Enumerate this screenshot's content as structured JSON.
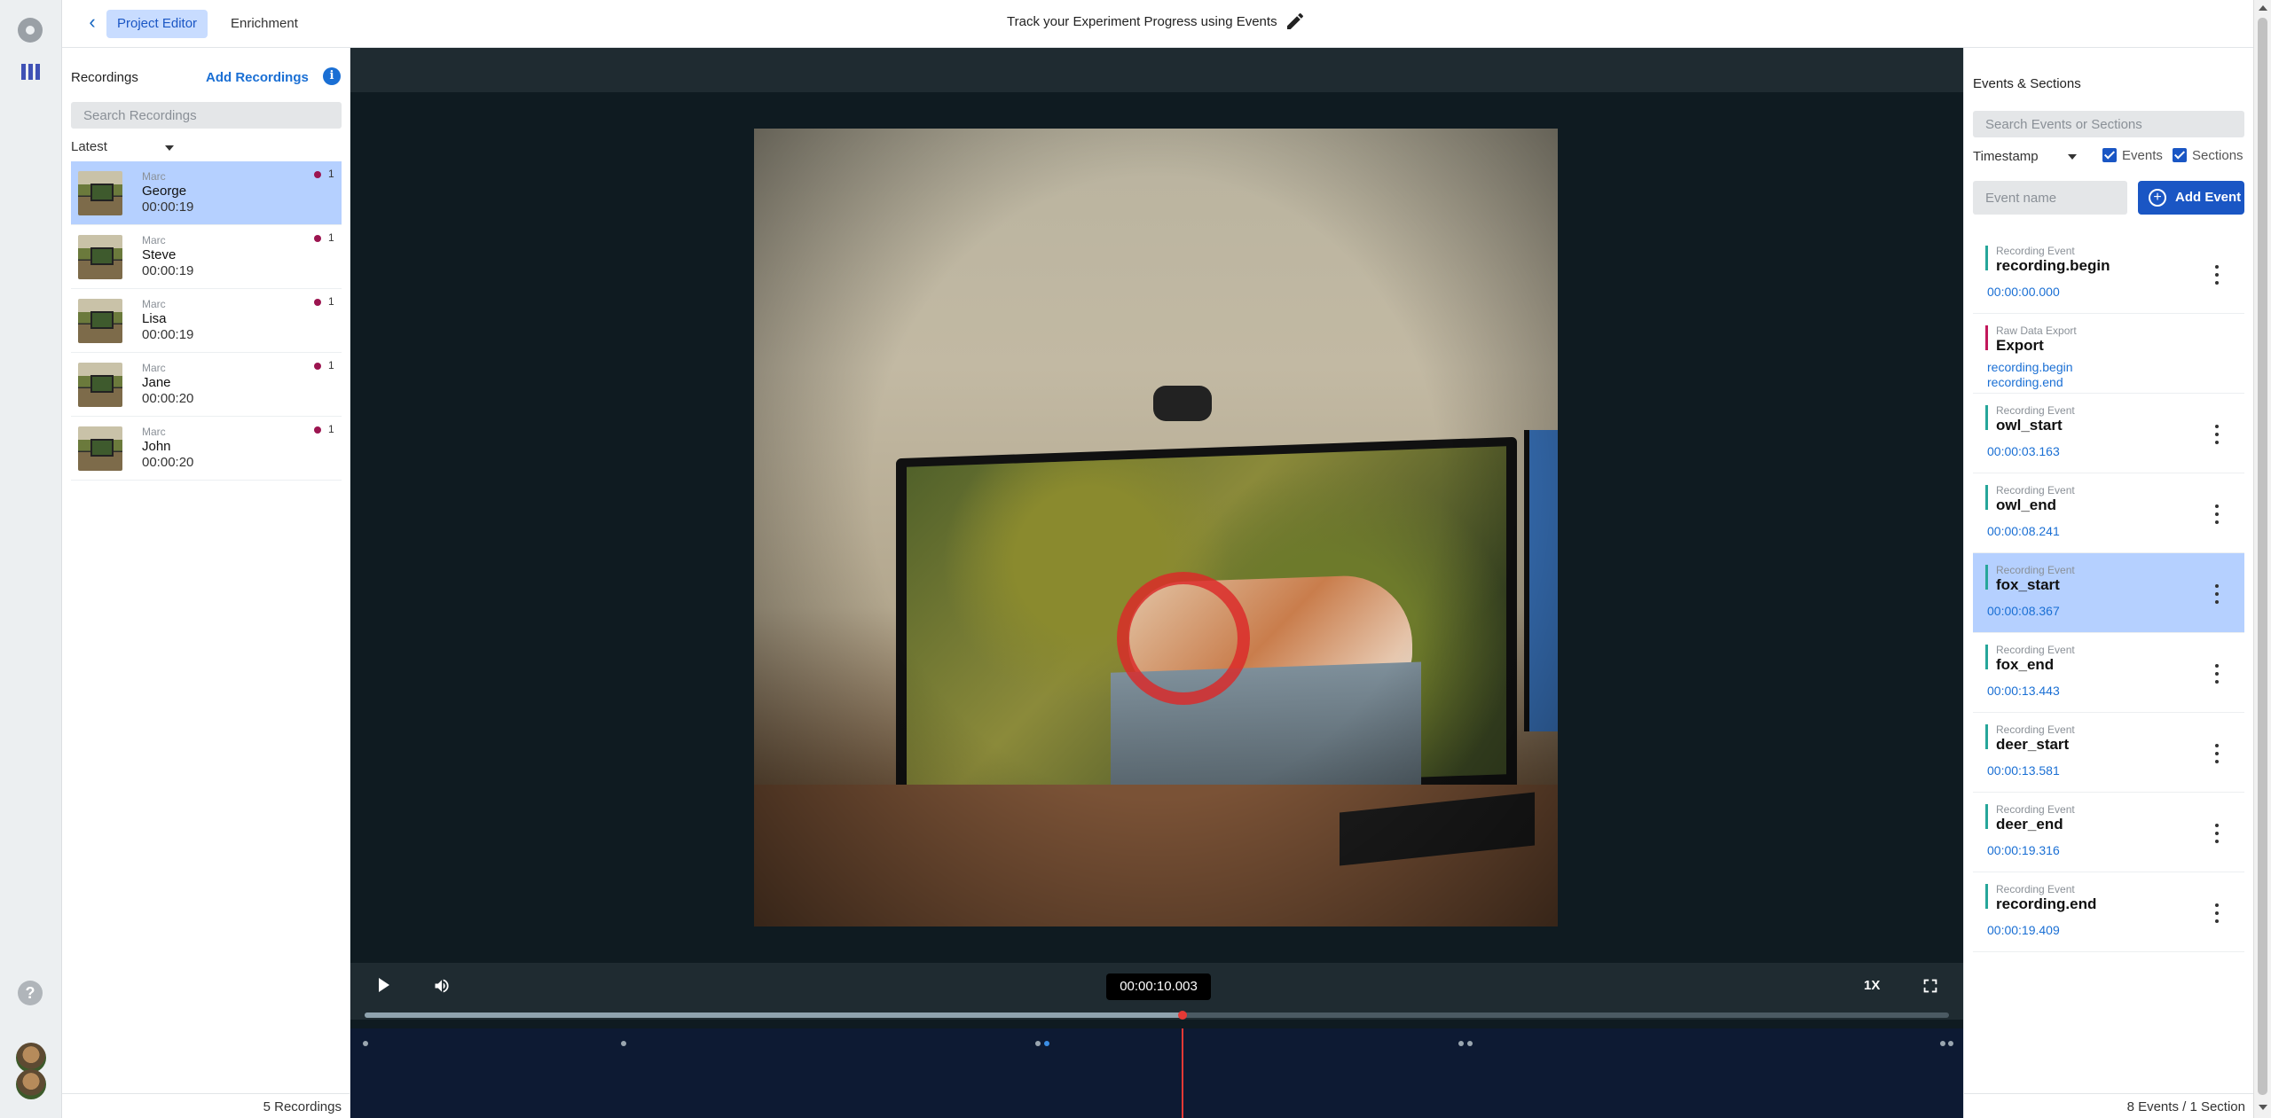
{
  "header": {
    "tabs": [
      {
        "label": "Project Editor",
        "active": true
      },
      {
        "label": "Enrichment",
        "active": false
      }
    ],
    "project_title": "Track your Experiment Progress using Events"
  },
  "recordings": {
    "title": "Recordings",
    "add_label": "Add Recordings",
    "search_placeholder": "Search Recordings",
    "sort": "Latest",
    "items": [
      {
        "owner": "Marc",
        "name": "George",
        "duration": "00:00:19",
        "count": "1",
        "selected": true
      },
      {
        "owner": "Marc",
        "name": "Steve",
        "duration": "00:00:19",
        "count": "1",
        "selected": false
      },
      {
        "owner": "Marc",
        "name": "Lisa",
        "duration": "00:00:19",
        "count": "1",
        "selected": false
      },
      {
        "owner": "Marc",
        "name": "Jane",
        "duration": "00:00:20",
        "count": "1",
        "selected": false
      },
      {
        "owner": "Marc",
        "name": "John",
        "duration": "00:00:20",
        "count": "1",
        "selected": false
      }
    ],
    "footer": "5 Recordings"
  },
  "player": {
    "timecode": "00:00:10.003",
    "speed": "1X",
    "progress": 0.516
  },
  "events_panel": {
    "title": "Events & Sections",
    "search_placeholder": "Search Events or Sections",
    "sort": "Timestamp",
    "filter_events": "Events",
    "filter_sections": "Sections",
    "name_placeholder": "Event name",
    "add_label": "Add Event",
    "items": [
      {
        "type": "Recording Event",
        "name": "recording.begin",
        "time": "00:00:00.000",
        "kind": "event"
      },
      {
        "type": "Raw Data Export",
        "name": "Export",
        "from": "recording.begin",
        "to": "recording.end",
        "kind": "section"
      },
      {
        "type": "Recording Event",
        "name": "owl_start",
        "time": "00:00:03.163",
        "kind": "event"
      },
      {
        "type": "Recording Event",
        "name": "owl_end",
        "time": "00:00:08.241",
        "kind": "event"
      },
      {
        "type": "Recording Event",
        "name": "fox_start",
        "time": "00:00:08.367",
        "kind": "event",
        "selected": true
      },
      {
        "type": "Recording Event",
        "name": "fox_end",
        "time": "00:00:13.443",
        "kind": "event"
      },
      {
        "type": "Recording Event",
        "name": "deer_start",
        "time": "00:00:13.581",
        "kind": "event"
      },
      {
        "type": "Recording Event",
        "name": "deer_end",
        "time": "00:00:19.316",
        "kind": "event"
      },
      {
        "type": "Recording Event",
        "name": "recording.end",
        "time": "00:00:19.409",
        "kind": "event"
      }
    ],
    "footer": "8 Events / 1 Section"
  },
  "colors": {
    "accent": "#1a56c4",
    "selection": "#b5d0ff",
    "event_bar": "#26a69a",
    "section_bar": "#c2185b",
    "playhead": "#e53935"
  }
}
